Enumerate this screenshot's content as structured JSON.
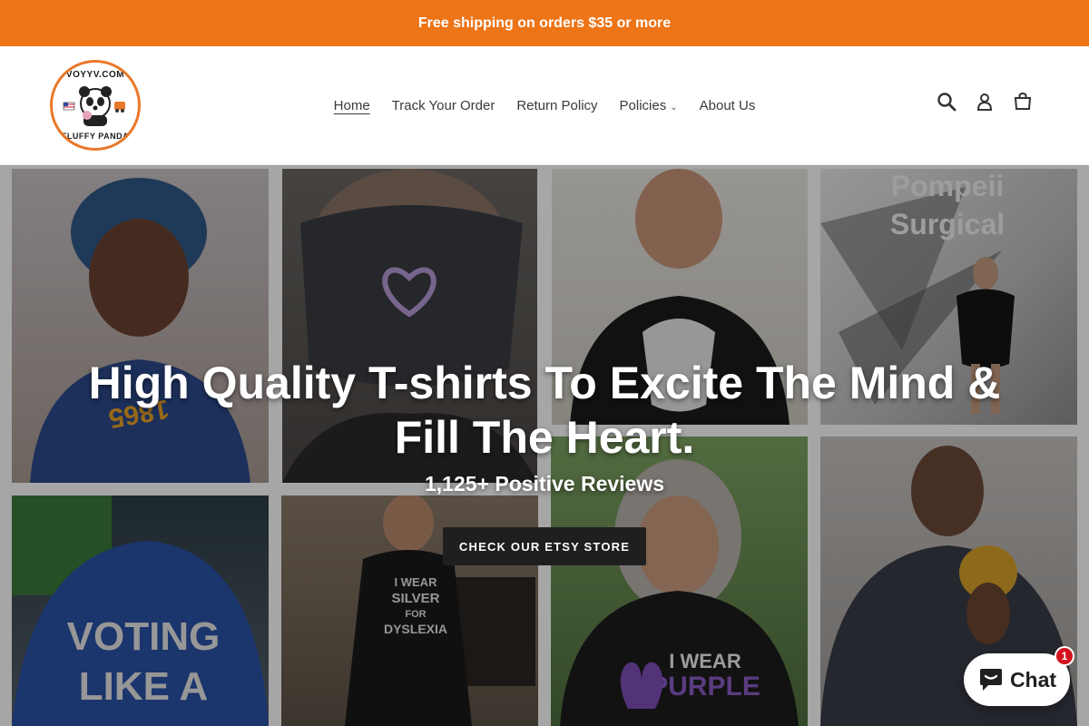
{
  "announcement": {
    "text": "Free shipping on orders $35 or more"
  },
  "logo": {
    "top_text": "VOYYV.COM",
    "bottom_text": "FLUFFY PANDA"
  },
  "nav": {
    "home": "Home",
    "track": "Track Your Order",
    "returns": "Return Policy",
    "policies": "Policies",
    "about": "About Us"
  },
  "icons": {
    "search": "search-icon",
    "account": "account-icon",
    "cart": "cart-icon"
  },
  "hero": {
    "title": "High Quality T-shirts To Excite The Mind & Fill The Heart.",
    "subtitle": "1,125+ Positive Reviews",
    "cta": "CHECK OUR ETSY STORE",
    "tile_texts": {
      "voting": "VOTING LIKE A GIRL",
      "pompeii": "Pompeii Surgical",
      "silver": "I WEAR SILVER FOR DYSLEXIA AWARENESS",
      "purple": "I WEAR PURPLE IN MEMORY OF MY SON"
    }
  },
  "chat": {
    "label": "Chat",
    "badge": "1"
  },
  "colors": {
    "accent": "#ed7417",
    "cta_bg": "#1f1f1f",
    "badge": "#d3121e"
  }
}
